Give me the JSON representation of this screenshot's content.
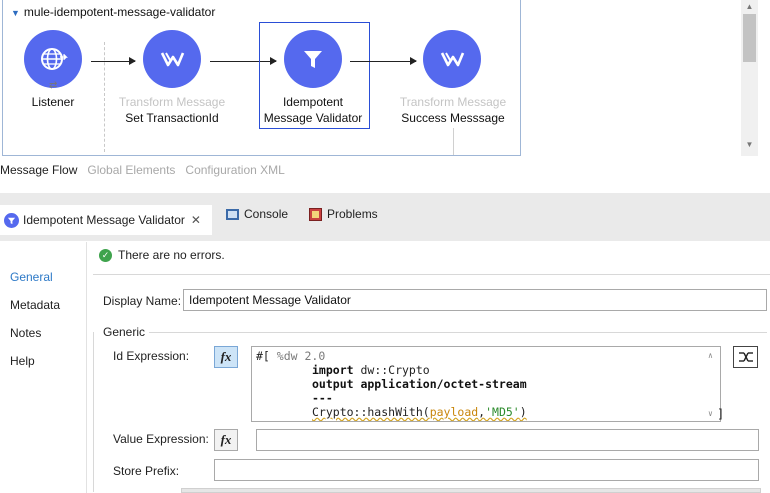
{
  "flow": {
    "title": "mule-idempotent-message-validator",
    "nodes": [
      {
        "name": "Listener",
        "sub": ""
      },
      {
        "name": "Set TransactionId",
        "sub": "Transform Message"
      },
      {
        "name": "Idempotent Message Validator",
        "sub": ""
      },
      {
        "name": "Success Messsage",
        "sub": "Transform Message"
      }
    ],
    "node_labels": {
      "listener": "Listener",
      "transform1_type": "Transform Message",
      "transform1_name": "Set TransactionId",
      "validator_line1": "Idempotent",
      "validator_line2": "Message Validator",
      "transform2_type": "Transform Message",
      "transform2_name": "Success Messsage"
    }
  },
  "canvas_tabs": {
    "message_flow": "Message Flow",
    "global_elements": "Global Elements",
    "configuration_xml": "Configuration XML"
  },
  "editor_tabs": {
    "properties": "Idempotent Message Validator",
    "console": "Console",
    "problems": "Problems"
  },
  "left_nav": {
    "general": "General",
    "metadata": "Metadata",
    "notes": "Notes",
    "help": "Help"
  },
  "status": "There are no errors.",
  "form": {
    "display_name_label": "Display Name:",
    "display_name_value": "Idempotent Message Validator",
    "group_label": "Generic",
    "id_expression_label": "Id Expression:",
    "value_expression_label": "Value Expression:",
    "store_prefix_label": "Store Prefix:",
    "fx_label": "fx",
    "code": {
      "line1_prefix": "#[ ",
      "line1_comment": "%dw 2.0",
      "line2_kw": "import",
      "line2_rest": " dw::Crypto",
      "line3": "output application/octet-stream",
      "line4": "---",
      "line5_fn": "Crypto::hashWith(",
      "line5_payload": "payload",
      "line5_sep": ",",
      "line5_str": "'MD5'",
      "line5_end": ")",
      "closing": "]"
    }
  },
  "colors": {
    "node_fill": "#5569ee",
    "selection_border": "#2a4ed6",
    "nav_active": "#2d79c7",
    "ok_green": "#3fa34d"
  }
}
